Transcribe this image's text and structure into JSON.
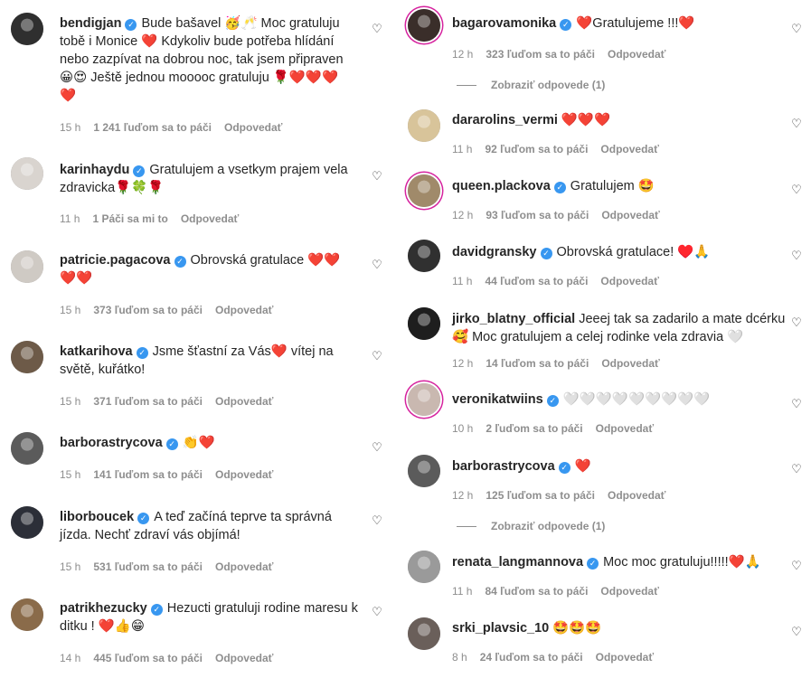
{
  "left_comments": [
    {
      "username": "bendigjan",
      "text": "Bude bašavel 🥳🥂 Moc gratuluju tobě i Monice ❤️ Kdykoliv bude potřeba hlídání nebo zazpívat na dobrou noc, tak jsem připraven 😀😍 Ještě jednou mooooc gratuluju 🌹❤️❤️❤️❤️",
      "time": "15 h",
      "likes": "1 241 ľuďom sa to páči",
      "reply": "Odpovedať",
      "avatar_color": "#2f2f2f"
    },
    {
      "username": "karinhaydu",
      "text": "Gratulujem a vsetkym prajem vela zdravicka🌹🍀🌹",
      "time": "11 h",
      "likes": "1 Páči sa mi to",
      "reply": "Odpovedať",
      "avatar_color": "#d9d4cf"
    },
    {
      "username": "patricie.pagacova",
      "text": "Obrovská gratulace ❤️❤️ ❤️❤️",
      "time": "15 h",
      "likes": "373 ľuďom sa to páči",
      "reply": "Odpovedať",
      "avatar_color": "#cfcac4"
    },
    {
      "username": "katkarihova",
      "text": "Jsme šťastní za Vás❤️ vítej na světě, kuřátko!",
      "time": "15 h",
      "likes": "371 ľuďom sa to páči",
      "reply": "Odpovedať",
      "avatar_color": "#6d5a48"
    },
    {
      "username": "barborastrycova",
      "text": "👏❤️",
      "time": "15 h",
      "likes": "141 ľuďom sa to páči",
      "reply": "Odpovedať",
      "avatar_color": "#5b5b5b"
    },
    {
      "username": "liborboucek",
      "text": "A teď začíná teprve ta správná jízda. Nechť zdraví vás objímá!",
      "time": "15 h",
      "likes": "531 ľuďom sa to páči",
      "reply": "Odpovedať",
      "avatar_color": "#2c2f38"
    },
    {
      "username": "patrikhezucky",
      "text": "Hezucti gratuluji rodine maresu k ditku ! ❤️👍😁",
      "time": "14 h",
      "likes": "445 ľuďom sa to páči",
      "reply": "Odpovedať",
      "avatar_color": "#8a6b4a"
    }
  ],
  "right_comments": [
    {
      "username": "bagarovamonika",
      "text": "❤️Gratulujeme !!!❤️",
      "time": "12 h",
      "likes": "323 ľuďom sa to páči",
      "reply": "Odpovedať",
      "avatar_color": "#3a2e2a",
      "view_replies": "Zobraziť odpovede (1)"
    },
    {
      "username": "dararolins_vermi",
      "text": "❤️❤️❤️",
      "time": "11 h",
      "likes": "92 ľuďom sa to páči",
      "reply": "Odpovedať",
      "avatar_color": "#d8c49a"
    },
    {
      "username": "queen.plackova",
      "text": "Gratulujem 🤩",
      "time": "12 h",
      "likes": "93 ľuďom sa to páči",
      "reply": "Odpovedať",
      "avatar_color": "#a08a6a"
    },
    {
      "username": "davidgransky",
      "text": "Obrovská gratulace! ♥️🙏",
      "time": "11 h",
      "likes": "44 ľuďom sa to páči",
      "reply": "Odpovedať",
      "avatar_color": "#303030"
    },
    {
      "username": "jirko_blatny_official",
      "text": "Jeeej tak sa zadarilo a mate dcérku 🥰 Moc gratulujem a celej rodinke vela zdravia 🤍",
      "time": "12 h",
      "likes": "14 ľuďom sa to páči",
      "reply": "Odpovedať",
      "avatar_color": "#1e1e1e"
    },
    {
      "username": "veronikatwiins",
      "text": "🤍🤍🤍🤍🤍🤍🤍🤍🤍",
      "time": "10 h",
      "likes": "2 ľuďom sa to páči",
      "reply": "Odpovedať",
      "avatar_color": "#c9b8b0"
    },
    {
      "username": "barborastrycova",
      "text": "❤️",
      "time": "12 h",
      "likes": "125 ľuďom sa to páči",
      "reply": "Odpovedať",
      "avatar_color": "#5b5b5b",
      "view_replies": "Zobraziť odpovede (1)"
    },
    {
      "username": "renata_langmannova",
      "text": "Moc moc gratuluju!!!!!❤️🙏",
      "time": "11 h",
      "likes": "84 ľuďom sa to páči",
      "reply": "Odpovedať",
      "avatar_color": "#9a9a9a"
    },
    {
      "username": "srki_plavsic_10",
      "text": "🤩🤩🤩",
      "time": "8 h",
      "likes": "24 ľuďom sa to páči",
      "reply": "Odpovedať",
      "avatar_color": "#6a5f5a"
    }
  ],
  "icons": {
    "verified": "verified-badge-icon",
    "like": "heart-outline-icon"
  },
  "colors": {
    "accent": "#3897f0",
    "muted": "#8e8e8e",
    "text": "#262626",
    "story_ring": "#d6249f"
  }
}
